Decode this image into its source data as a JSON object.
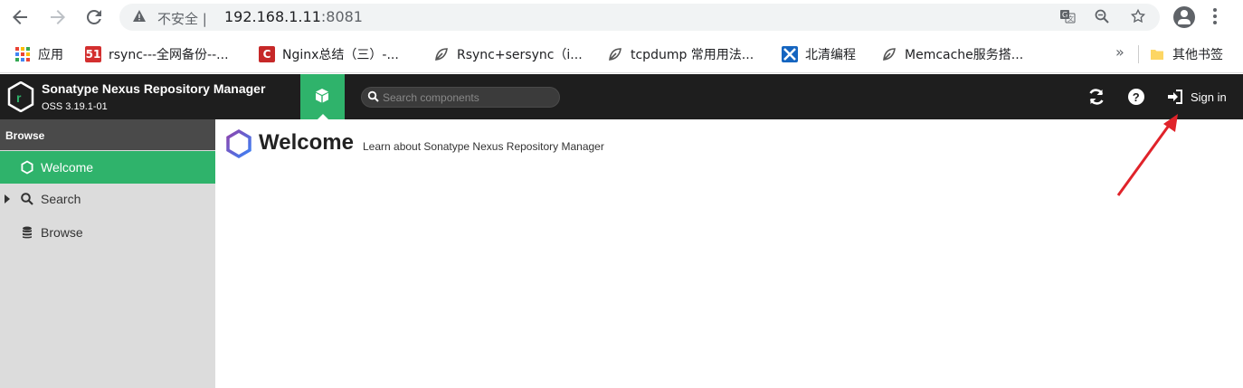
{
  "browser": {
    "back_icon": "arrow-left-icon",
    "forward_icon": "arrow-right-icon",
    "reload_icon": "reload-icon",
    "insecure_label": "不安全",
    "url_host": "192.168.1.11",
    "url_port": ":8081",
    "separator": "|"
  },
  "bookmarks": {
    "items": [
      {
        "label": "应用",
        "icon": "apps-grid-icon"
      },
      {
        "label": "rsync---全网备份--...",
        "icon": "site-51-icon",
        "icon_text": "51",
        "icon_color": "#d32f2f"
      },
      {
        "label": "Nginx总结（三）-...",
        "icon": "site-c-icon",
        "icon_text": "C",
        "icon_color": "#c62828"
      },
      {
        "label": "Rsync+sersync（i...",
        "icon": "site-leaf-icon"
      },
      {
        "label": "tcpdump 常用用法...",
        "icon": "site-leaf-icon"
      },
      {
        "label": "北清编程",
        "icon": "site-x-icon",
        "icon_color": "#1565c0"
      },
      {
        "label": "Memcache服务搭...",
        "icon": "site-leaf-icon"
      }
    ],
    "more": "»",
    "other_folder": "其他书签"
  },
  "nexus": {
    "product_title": "Sonatype Nexus Repository Manager",
    "version": "OSS 3.19.1-01",
    "search_placeholder": "Search components",
    "sign_in": "Sign in",
    "accent_color": "#2fb36b"
  },
  "sidebar": {
    "heading": "Browse",
    "items": [
      {
        "label": "Welcome",
        "icon": "hexagon-icon",
        "active": true
      },
      {
        "label": "Search",
        "icon": "search-icon",
        "active": false,
        "expandable": true
      },
      {
        "label": "Browse",
        "icon": "database-icon",
        "active": false
      }
    ]
  },
  "main": {
    "title": "Welcome",
    "subtitle": "Learn about Sonatype Nexus Repository Manager"
  }
}
